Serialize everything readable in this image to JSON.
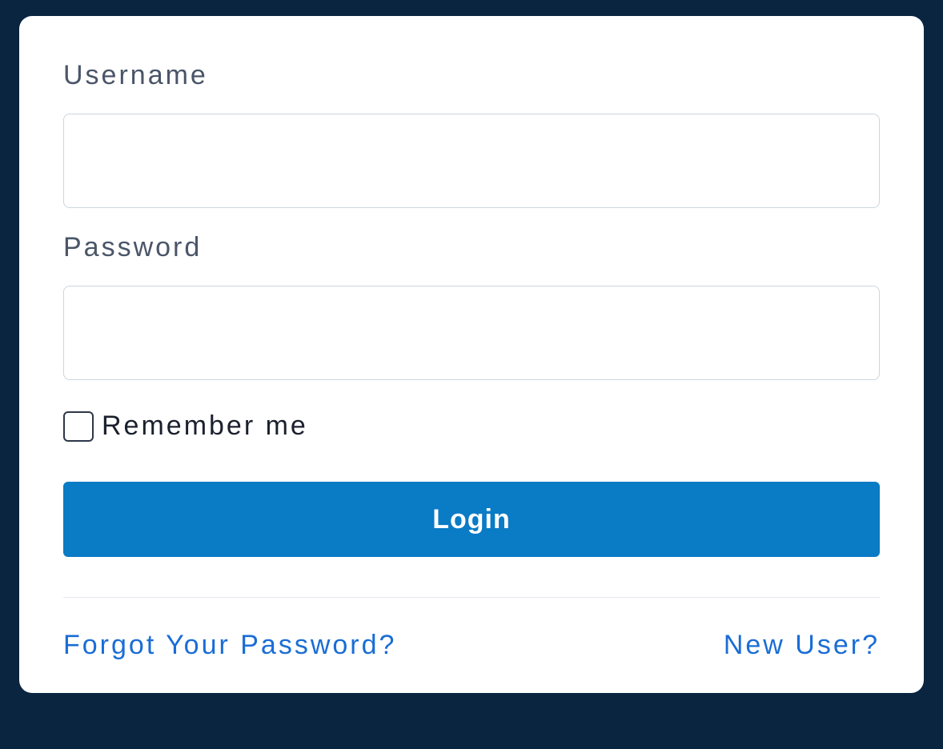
{
  "form": {
    "username_label": "Username",
    "username_value": "",
    "password_label": "Password",
    "password_value": "",
    "remember_label": "Remember me",
    "remember_checked": false,
    "submit_label": "Login"
  },
  "links": {
    "forgot_password": "Forgot Your Password?",
    "new_user": "New User?"
  },
  "colors": {
    "accent": "#0a7bc5",
    "link": "#1a6dd6",
    "background": "#0a2540"
  }
}
